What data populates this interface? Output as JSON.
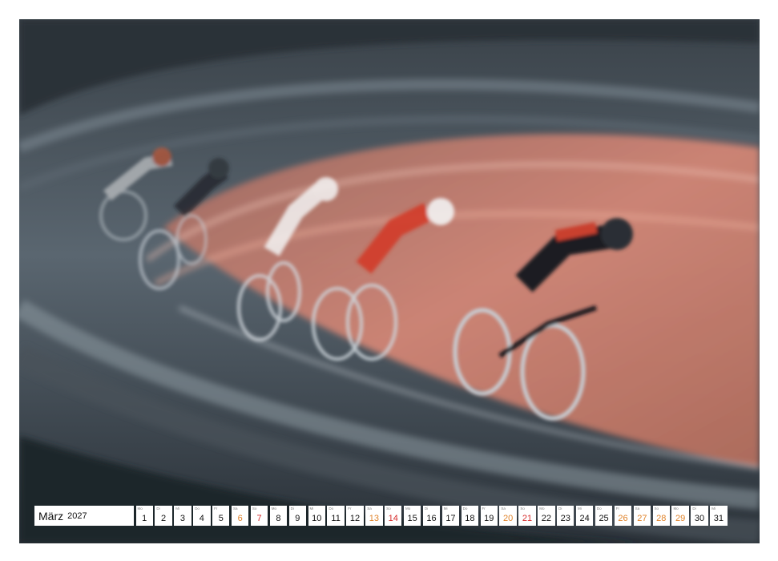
{
  "calendar": {
    "month": "März",
    "year": "2027",
    "days": [
      {
        "dow": "Mo",
        "num": "1",
        "type": "weekday"
      },
      {
        "dow": "Di",
        "num": "2",
        "type": "weekday"
      },
      {
        "dow": "Mi",
        "num": "3",
        "type": "weekday"
      },
      {
        "dow": "Do",
        "num": "4",
        "type": "weekday"
      },
      {
        "dow": "Fr",
        "num": "5",
        "type": "weekday"
      },
      {
        "dow": "Sa",
        "num": "6",
        "type": "sat"
      },
      {
        "dow": "So",
        "num": "7",
        "type": "sun"
      },
      {
        "dow": "Mo",
        "num": "8",
        "type": "weekday"
      },
      {
        "dow": "Di",
        "num": "9",
        "type": "weekday"
      },
      {
        "dow": "Mi",
        "num": "10",
        "type": "weekday"
      },
      {
        "dow": "Do",
        "num": "11",
        "type": "weekday"
      },
      {
        "dow": "Fr",
        "num": "12",
        "type": "weekday"
      },
      {
        "dow": "Sa",
        "num": "13",
        "type": "sat"
      },
      {
        "dow": "So",
        "num": "14",
        "type": "sun"
      },
      {
        "dow": "Mo",
        "num": "15",
        "type": "weekday"
      },
      {
        "dow": "Di",
        "num": "16",
        "type": "weekday"
      },
      {
        "dow": "Mi",
        "num": "17",
        "type": "weekday"
      },
      {
        "dow": "Do",
        "num": "18",
        "type": "weekday"
      },
      {
        "dow": "Fr",
        "num": "19",
        "type": "weekday"
      },
      {
        "dow": "Sa",
        "num": "20",
        "type": "sat"
      },
      {
        "dow": "So",
        "num": "21",
        "type": "sun"
      },
      {
        "dow": "Mo",
        "num": "22",
        "type": "weekday"
      },
      {
        "dow": "Di",
        "num": "23",
        "type": "weekday"
      },
      {
        "dow": "Mi",
        "num": "24",
        "type": "weekday"
      },
      {
        "dow": "Do",
        "num": "25",
        "type": "weekday"
      },
      {
        "dow": "Fr",
        "num": "26",
        "type": "sat"
      },
      {
        "dow": "Sa",
        "num": "27",
        "type": "sat"
      },
      {
        "dow": "So",
        "num": "28",
        "type": "sat"
      },
      {
        "dow": "Mo",
        "num": "29",
        "type": "sat"
      },
      {
        "dow": "Di",
        "num": "30",
        "type": "weekday"
      },
      {
        "dow": "Mi",
        "num": "31",
        "type": "weekday"
      }
    ]
  },
  "colors": {
    "weekend_sat": "#e0832a",
    "weekend_sun": "#d62a2a",
    "track_accent": "#d9826c"
  }
}
